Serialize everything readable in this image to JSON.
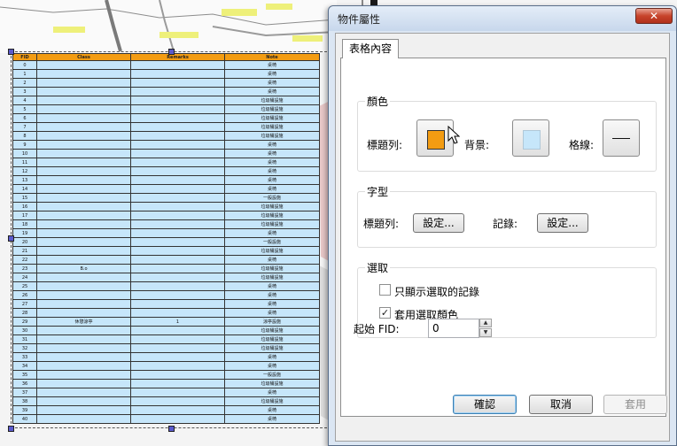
{
  "dialog": {
    "title": "物件屬性",
    "close_label": "✕",
    "tab_label": "表格內容",
    "color_group": {
      "title": "顏色",
      "header_label": "標題列:",
      "header_color": "#f39c12",
      "background_label": "背景:",
      "background_color": "#c6e6fa",
      "grid_label": "格線:"
    },
    "font_group": {
      "title": "字型",
      "header_label": "標題列:",
      "header_button": "設定...",
      "record_label": "記錄:",
      "record_button": "設定..."
    },
    "selection_group": {
      "title": "選取",
      "show_selected_label": "只顯示選取的記錄",
      "show_selected_checked": false,
      "apply_color_label": "套用選取顏色",
      "apply_color_checked": true
    },
    "start_fid_label": "起始 FID:",
    "start_fid_value": "0",
    "ok_button": "確認",
    "cancel_button": "取消",
    "apply_button": "套用"
  },
  "table": {
    "headers": [
      "FID",
      "Class",
      "Remarks",
      "Note"
    ],
    "rows": [
      [
        "0",
        "",
        "",
        "桌椅"
      ],
      [
        "1",
        "",
        "",
        "桌椅"
      ],
      [
        "2",
        "",
        "",
        "桌椅"
      ],
      [
        "3",
        "",
        "",
        "桌椅"
      ],
      [
        "4",
        "",
        "",
        "垃圾桶設施"
      ],
      [
        "5",
        "",
        "",
        "垃圾桶設施"
      ],
      [
        "6",
        "",
        "",
        "垃圾桶設施"
      ],
      [
        "7",
        "",
        "",
        "垃圾桶設施"
      ],
      [
        "8",
        "",
        "",
        "垃圾桶設施"
      ],
      [
        "9",
        "",
        "",
        "桌椅"
      ],
      [
        "10",
        "",
        "",
        "桌椅"
      ],
      [
        "11",
        "",
        "",
        "桌椅"
      ],
      [
        "12",
        "",
        "",
        "桌椅"
      ],
      [
        "13",
        "",
        "",
        "桌椅"
      ],
      [
        "14",
        "",
        "",
        "桌椅"
      ],
      [
        "15",
        "",
        "",
        "一般設施"
      ],
      [
        "16",
        "",
        "",
        "垃圾桶設施"
      ],
      [
        "17",
        "",
        "",
        "垃圾桶設施"
      ],
      [
        "18",
        "",
        "",
        "垃圾桶設施"
      ],
      [
        "19",
        "",
        "",
        "桌椅"
      ],
      [
        "20",
        "",
        "",
        "一般設施"
      ],
      [
        "21",
        "",
        "",
        "垃圾桶設施"
      ],
      [
        "22",
        "",
        "",
        "桌椅"
      ],
      [
        "23",
        "B.o",
        "",
        "垃圾桶設施"
      ],
      [
        "24",
        "",
        "",
        "垃圾桶設施"
      ],
      [
        "25",
        "",
        "",
        "桌椅"
      ],
      [
        "26",
        "",
        "",
        "桌椅"
      ],
      [
        "27",
        "",
        "",
        "桌椅"
      ],
      [
        "28",
        "",
        "",
        "桌椅"
      ],
      [
        "29",
        "休憩涼亭",
        "1",
        "涼亭設施"
      ],
      [
        "30",
        "",
        "",
        "垃圾桶設施"
      ],
      [
        "31",
        "",
        "",
        "垃圾桶設施"
      ],
      [
        "32",
        "",
        "",
        "垃圾桶設施"
      ],
      [
        "33",
        "",
        "",
        "桌椅"
      ],
      [
        "34",
        "",
        "",
        "桌椅"
      ],
      [
        "35",
        "",
        "",
        "一般設施"
      ],
      [
        "36",
        "",
        "",
        "垃圾桶設施"
      ],
      [
        "37",
        "",
        "",
        "桌椅"
      ],
      [
        "38",
        "",
        "",
        "垃圾桶設施"
      ],
      [
        "39",
        "",
        "",
        "桌椅"
      ],
      [
        "40",
        "",
        "",
        "桌椅"
      ]
    ]
  }
}
